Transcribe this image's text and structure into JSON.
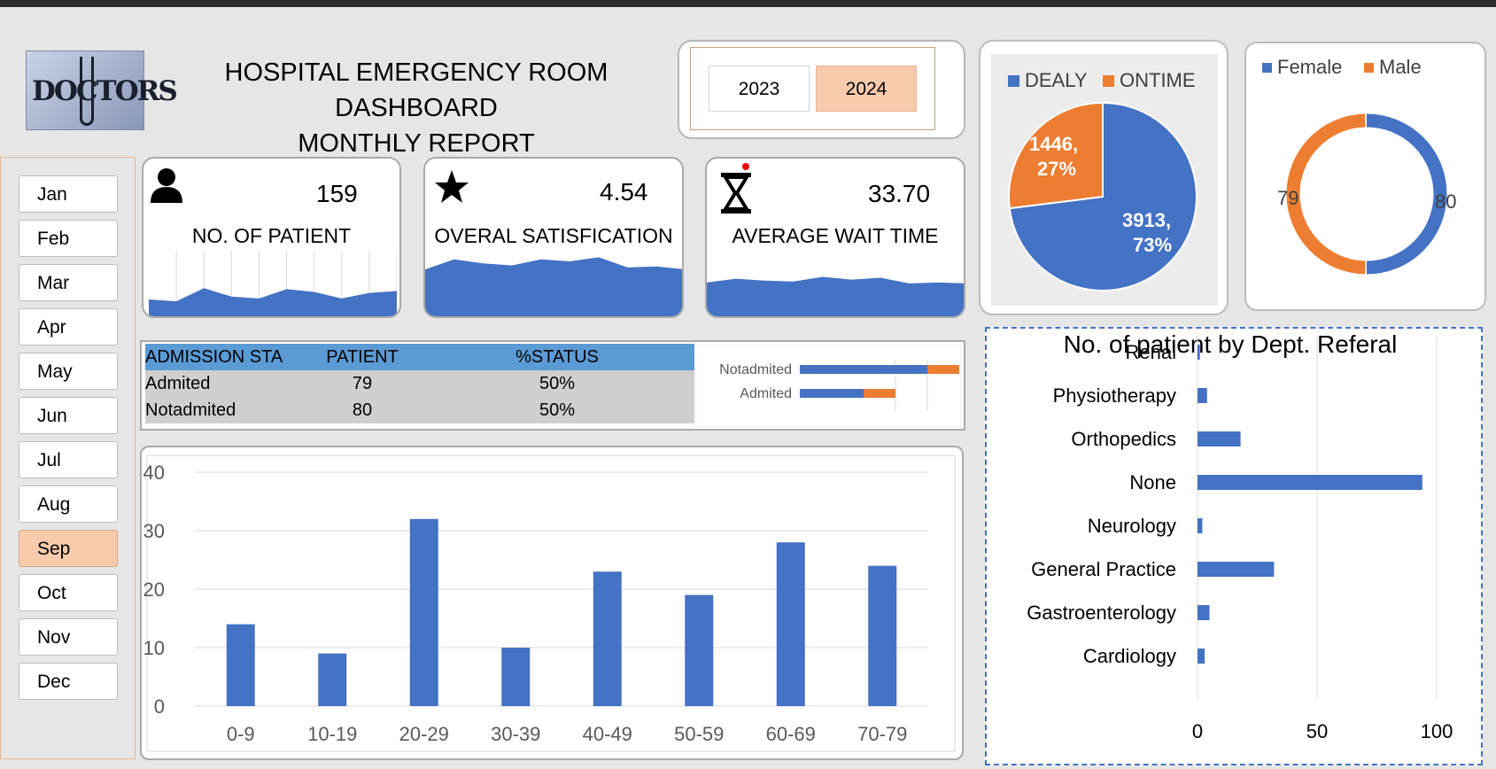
{
  "header": {
    "logo_text": "DOCTORS",
    "title_line1": "HOSPITAL EMERGENCY ROOM DASHBOARD",
    "title_line2": "MONTHLY REPORT"
  },
  "years": {
    "items": [
      "2023",
      "2024"
    ],
    "selected": "2024"
  },
  "months": {
    "items": [
      "Jan",
      "Feb",
      "Mar",
      "Apr",
      "May",
      "Jun",
      "Jul",
      "Aug",
      "Sep",
      "Oct",
      "Nov",
      "Dec"
    ],
    "selected": "Sep"
  },
  "kpis": {
    "patients": {
      "value": "159",
      "label": "NO. OF PATIENT",
      "icon": "person-icon"
    },
    "satisfaction": {
      "value": "4.54",
      "label": "OVERAL SATISFICATION",
      "icon": "star-icon"
    },
    "wait": {
      "value": "33.70",
      "label": "AVERAGE WAIT TIME",
      "icon": "hourglass-icon"
    }
  },
  "colors": {
    "blue": "#4472c4",
    "orange": "#ed7d31",
    "header_blue": "#5b9bd5",
    "selected": "#f8cbad"
  },
  "admission": {
    "headers": [
      "ADMISSION STA",
      "PATIENT",
      "%STATUS"
    ],
    "rows": [
      {
        "status": "Admited",
        "patient": "79",
        "pct": "50%"
      },
      {
        "status": "Notadmited",
        "patient": "80",
        "pct": "50%"
      }
    ]
  },
  "chart_data": [
    {
      "type": "area",
      "name": "patients-sparkline",
      "series": [
        {
          "values": [
            18,
            16,
            30,
            21,
            19,
            29,
            26,
            19,
            25,
            27
          ]
        }
      ],
      "ylim": [
        0,
        70
      ]
    },
    {
      "type": "area",
      "name": "satisfaction-sparkline",
      "series": [
        {
          "values": [
            48,
            58,
            54,
            52,
            58,
            56,
            60,
            50,
            51,
            48
          ]
        }
      ],
      "ylim": [
        0,
        70
      ]
    },
    {
      "type": "area",
      "name": "wait-sparkline",
      "series": [
        {
          "values": [
            38,
            42,
            40,
            39,
            44,
            41,
            43,
            37,
            38,
            37
          ]
        }
      ],
      "ylim": [
        0,
        70
      ]
    },
    {
      "type": "bar",
      "name": "admission-stacked-bar",
      "orientation": "horizontal",
      "categories": [
        "Notadmited",
        "Admited"
      ],
      "series": [
        {
          "values": [
            80,
            40
          ]
        },
        {
          "values": [
            20,
            20
          ]
        }
      ],
      "xlim": [
        0,
        100
      ]
    },
    {
      "type": "pie",
      "name": "delay-ontime-pie",
      "legend": [
        "DEALY",
        "ONTIME"
      ],
      "slices": [
        {
          "name": "DEALY",
          "value": 3913,
          "label": "3913,",
          "pct_label": "73%"
        },
        {
          "name": "ONTIME",
          "value": 1446,
          "label": "1446,",
          "pct_label": "27%"
        }
      ],
      "legend_position": "top"
    },
    {
      "type": "pie",
      "name": "gender-donut",
      "legend": [
        "Female",
        "Male"
      ],
      "slices": [
        {
          "name": "Female",
          "value": 80,
          "label": "80"
        },
        {
          "name": "Male",
          "value": 79,
          "label": "79"
        }
      ],
      "legend_position": "top"
    },
    {
      "type": "bar",
      "name": "age-group-bar",
      "categories": [
        "0-9",
        "10-19",
        "20-29",
        "30-39",
        "40-49",
        "50-59",
        "60-69",
        "70-79"
      ],
      "values": [
        14,
        9,
        32,
        10,
        23,
        19,
        28,
        24
      ],
      "ylim": [
        0,
        40
      ],
      "yticks": [
        "0",
        "10",
        "20",
        "30",
        "40"
      ],
      "grid": true
    },
    {
      "type": "bar",
      "name": "dept-referral-bar",
      "orientation": "horizontal",
      "title": "No. of patient by Dept. Referal",
      "categories": [
        "Renal",
        "Physiotherapy",
        "Orthopedics",
        "None",
        "Neurology",
        "General Practice",
        "Gastroenterology",
        "Cardiology"
      ],
      "values": [
        1,
        4,
        18,
        94,
        2,
        32,
        5,
        3
      ],
      "xlim": [
        0,
        100
      ],
      "xticks": [
        "0",
        "50",
        "100"
      ],
      "grid": true
    }
  ]
}
